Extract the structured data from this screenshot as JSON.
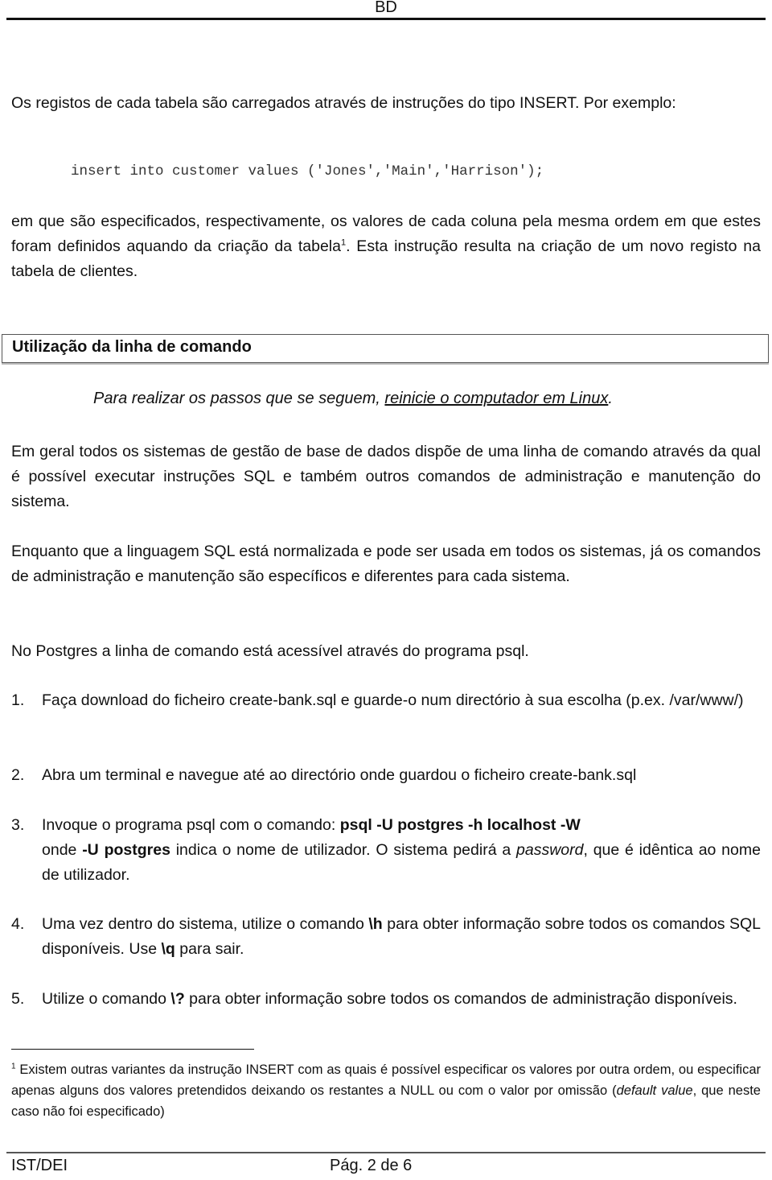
{
  "header": {
    "title": "BD"
  },
  "intro": {
    "paragraph": "Os registos de cada tabela são carregados através de instruções do tipo INSERT. Por exemplo:",
    "code": "insert into customer values ('Jones','Main','Harrison');",
    "explanation_before_ref": "em que são especificados, respectivamente, os valores de cada coluna pela mesma ordem em que estes foram definidos aquando da criação da tabela",
    "footnote_ref": "1",
    "explanation_after_ref": ". Esta instrução resulta na criação de um novo registo na tabela de clientes."
  },
  "section": {
    "title": "Utilização da linha de comando",
    "note_prefix": "Para realizar os passos que se seguem, ",
    "note_link": "reinicie o computador em Linux",
    "note_suffix": "."
  },
  "body": {
    "paragraphs": [
      "Em geral todos os sistemas de gestão de base de dados dispõe de uma linha de comando através da qual é possível executar instruções SQL e também outros comandos de administração e manutenção do sistema.",
      "Enquanto que a linguagem SQL está normalizada e pode ser usada em todos os sistemas, já os comandos de administração e manutenção são específicos e diferentes para cada sistema.",
      "No Postgres a linha de comando está acessível através do programa psql."
    ]
  },
  "steps": [
    {
      "num": "1.",
      "text": "Faça download do ficheiro create-bank.sql e guarde-o num directório à sua escolha (p.ex. /var/www/)"
    },
    {
      "num": "2.",
      "text": "Abra um terminal e navegue até ao directório onde guardou o ficheiro create-bank.sql"
    },
    {
      "num": "3.",
      "pre": "Invoque o programa psql com o comando: ",
      "cmd": "psql -U postgres -h localhost -W",
      "line2_pre": "onde ",
      "line2_bold": "-U postgres",
      "line2_mid": " indica o nome de utilizador. O sistema pedirá a ",
      "line2_italic": "password",
      "line2_post": ", que é idêntica ao nome de utilizador."
    },
    {
      "num": "4.",
      "pre": "Uma vez dentro do sistema, utilize o comando ",
      "cmd1": "\\h",
      "mid": " para obter informação sobre todos os comandos SQL disponíveis. Use ",
      "cmd2": "\\q",
      "post": " para sair."
    },
    {
      "num": "5.",
      "pre": "Utilize o comando ",
      "cmd": "\\?",
      "post": " para obter informação sobre todos os comandos de administração disponíveis."
    }
  ],
  "footnote": {
    "num": "1",
    "text_pre": " Existem outras variantes da instrução INSERT com as quais é possível especificar os valores por outra ordem, ou especificar apenas alguns dos valores pretendidos deixando os restantes a NULL ou com o valor por omissão (",
    "text_italic": "default value",
    "text_post": ", que neste caso não foi especificado)"
  },
  "footer": {
    "left": "IST/DEI",
    "page": "Pág. 2 de 6"
  }
}
